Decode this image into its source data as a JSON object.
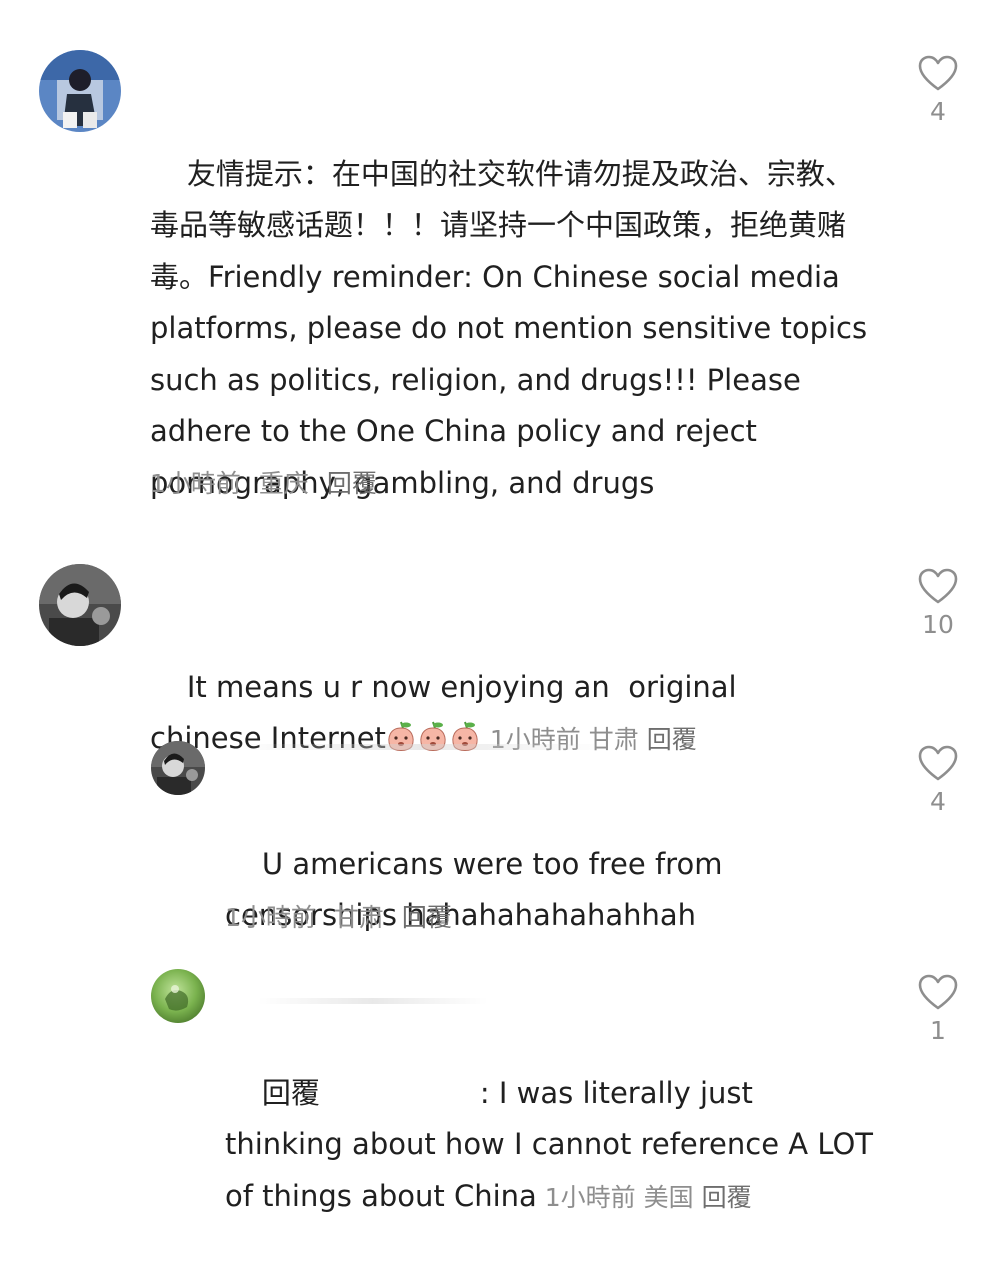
{
  "comments": [
    {
      "text": "友情提示：在中国的社交软件请勿提及政治、宗教、毒品等敏感话题！！！请坚持一个中国政策，拒绝黄赌毒。Friendly reminder: On Chinese social media platforms, please do not mention sensitive topics such as politics, religion, and drugs!!! Please adhere to the One China policy and reject pornography, gambling, and drugs",
      "time": "1小時前",
      "location": "重庆",
      "reply_label": "回覆",
      "likes": "4"
    },
    {
      "text": "It means u r now enjoying an  original chinese Internet",
      "time": "1小時前",
      "location": "甘肃",
      "reply_label": "回覆",
      "likes": "10"
    },
    {
      "text": "U americans were too free from censorships hahahahahahahhah",
      "time": "1小時前",
      "location": "甘肃",
      "reply_label": "回覆",
      "likes": "4"
    },
    {
      "reply_prefix": "回覆",
      "text": ": I was literally just thinking about how I cannot reference A LOT of things about China",
      "time": "1小時前",
      "location": "美国",
      "reply_label": "回覆",
      "likes": "1"
    }
  ],
  "icons": {
    "like": "heart-outline-icon",
    "emoji": "peach-emoji-icon"
  },
  "colors": {
    "text": "#202020",
    "meta": "#8e8e8e",
    "icon": "#8e8e8e"
  }
}
